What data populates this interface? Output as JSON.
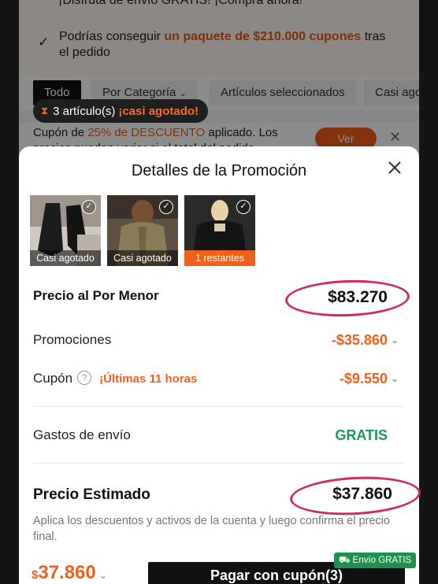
{
  "background": {
    "banner_line1": "¡Disfruta de envío GRATIS! ¡Compra ahora!",
    "banner_line2_a": "Podrías conseguir ",
    "banner_line2_b": "un paquete de $210.000 cupones",
    "banner_line2_c": " tras",
    "banner_line3": "el pedido",
    "tabs": [
      "Todo",
      "Por Categoría",
      "Artículos seleccionados",
      "Casi ago"
    ],
    "coupon_a": "Cupón de ",
    "coupon_b": "25% de DESCUENTO",
    "coupon_c": " aplicado. Los",
    "coupon_line2": "precios pueden variar si el total del pedido ...",
    "ver_label": "Ver"
  },
  "pill": {
    "count_text": "3 artículo(s)",
    "warn_text": "¡casi agotado!"
  },
  "sheet": {
    "title": "Detalles de la Promoción",
    "thumbs": [
      {
        "caption": "Casi agotado"
      },
      {
        "caption": "Casi agotado"
      },
      {
        "caption": "1 restantes"
      }
    ],
    "retail_label": "Precio al Por Menor",
    "retail_value": "$83.270",
    "promos_label": "Promociones",
    "promos_value": "-$35.860",
    "coupon_label": "Cupón",
    "coupon_hours": "¡Últimas 11 horas",
    "coupon_value": "-$9.550",
    "shipping_label": "Gastos de envío",
    "shipping_value": "GRATIS",
    "est_label": "Precio Estimado",
    "est_value": "$37.860",
    "note": "Aplica los descuentos y activos de la cuenta y luego confirma el precio final."
  },
  "footer": {
    "total_symbol": "$",
    "total_value": "37.860",
    "ship_badge": "Envío GRATIS",
    "pay_label": "Pagar con cupón(3)"
  },
  "colors": {
    "accent": "#f0611c",
    "green": "#1a9a52",
    "circle": "#d22b5c"
  }
}
